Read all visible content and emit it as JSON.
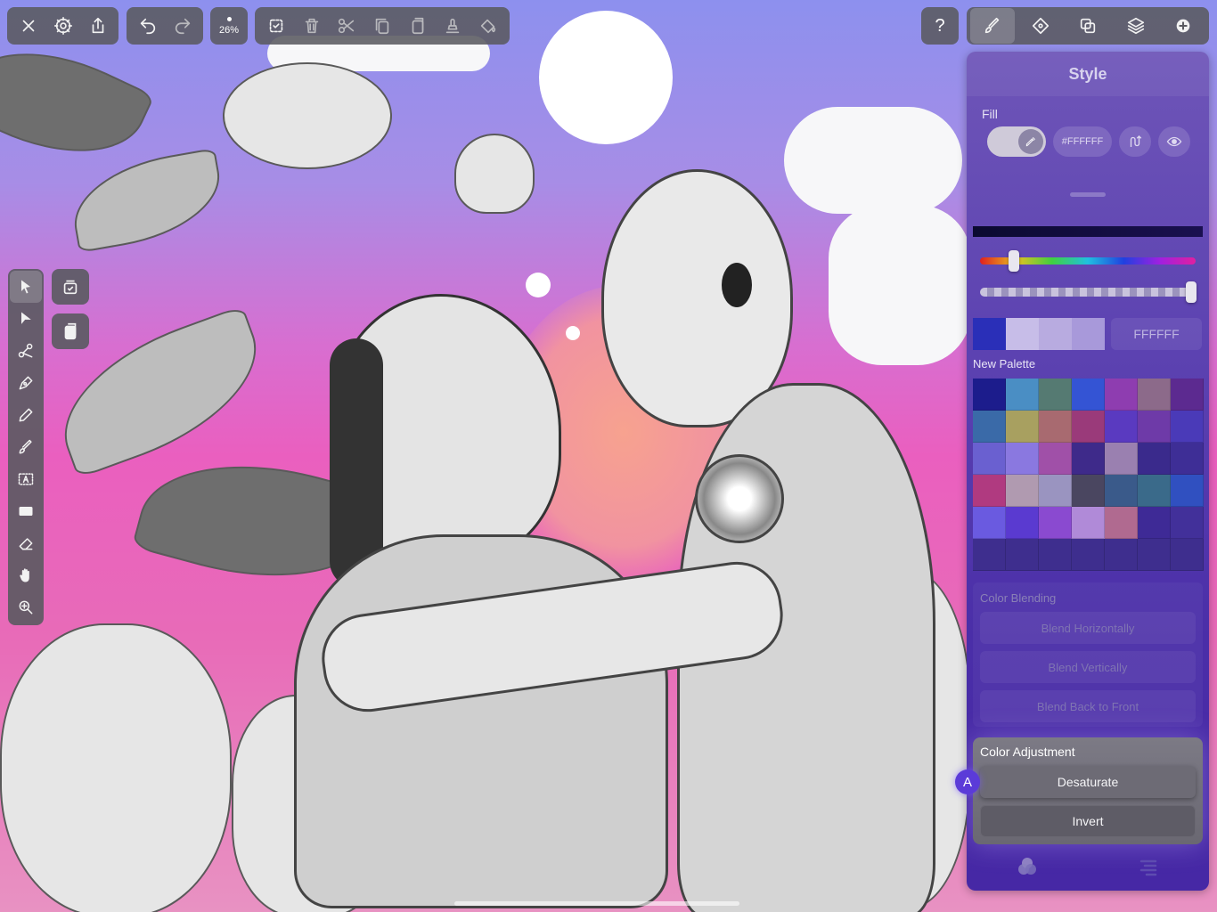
{
  "toolbar": {
    "zoom_label": "26%",
    "help_label": "?"
  },
  "panel": {
    "title": "Style",
    "fill_label": "Fill",
    "fill_hex": "#FFFFFF",
    "hex_field": "FFFFFF",
    "palette_title": "New Palette",
    "recent_colors": [
      "#2a2fb8",
      "#c7bde8",
      "#b8abe0",
      "#a899da"
    ],
    "palette_colors": [
      "#1c1c8c",
      "#4a8ec4",
      "#557a72",
      "#3454d4",
      "#8e3db0",
      "#8c6a8a",
      "#5c2a90",
      "#3a6aa8",
      "#a8a060",
      "#a86a70",
      "#9a3a7a",
      "#5a3ac0",
      "#6e3aa8",
      "#4a3ab8",
      "#6a60d0",
      "#8a78e0",
      "#a050a8",
      "#3e2a8a",
      "#9a80b0",
      "#3a2a8c",
      "#3e2e96",
      "#b03a80",
      "#b09ab0",
      "#9a94c0",
      "#4a4660",
      "#3a5a8a",
      "#3a6a8a",
      "#3050c0",
      "#6a5ae0",
      "#5a3ad0",
      "#8a4ad0",
      "#b08ad8",
      "#b06a90",
      "#3e2a96",
      "#42309a",
      "#3e2e8e",
      "#3e2e8e",
      "#3e2e8e",
      "#3e2e8e",
      "#3e2e8e",
      "#3e2e8e",
      "#3e2e8e"
    ],
    "blending": {
      "title": "Color Blending",
      "buttons": [
        "Blend Horizontally",
        "Blend Vertically",
        "Blend Back to Front"
      ]
    },
    "adjustment": {
      "title": "Color Adjustment",
      "desaturate": "Desaturate",
      "invert": "Invert"
    },
    "shortcut_badge": "A"
  }
}
